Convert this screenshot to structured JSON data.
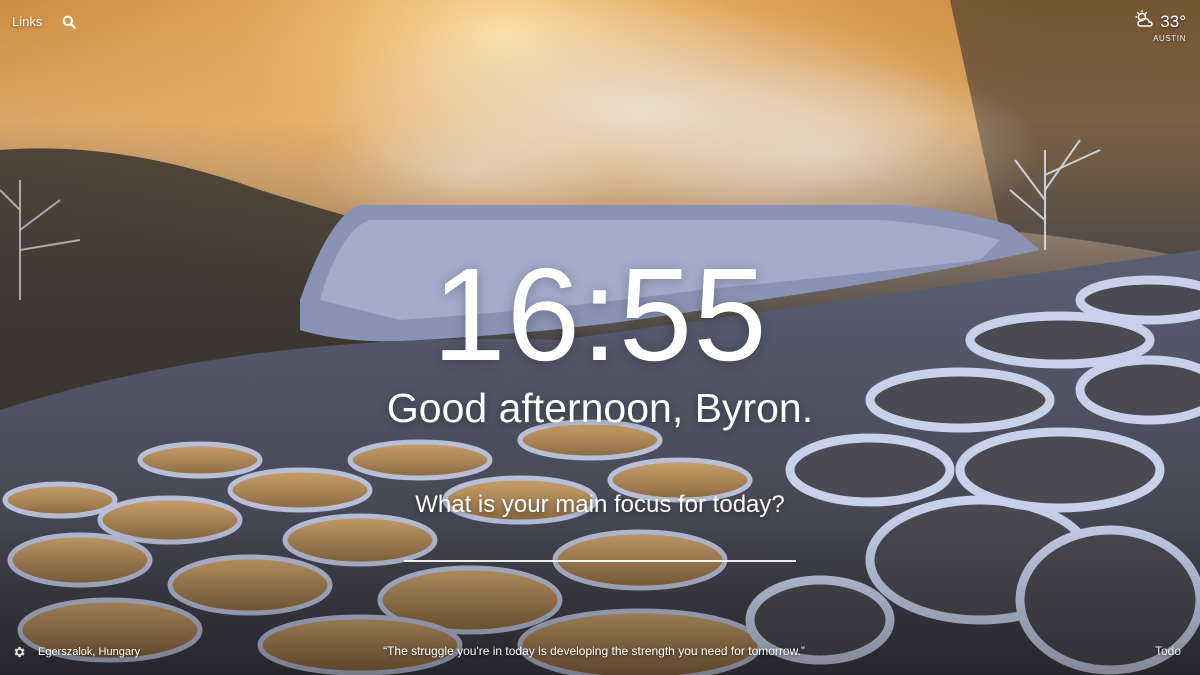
{
  "background": {
    "scene": "Terraced travertine pools with steam at sunset",
    "photo_location": "Egerszalok, Hungary"
  },
  "top_left": {
    "links_label": "Links",
    "search_icon": "search-icon"
  },
  "weather": {
    "icon": "partly-cloudy-icon",
    "temperature": "33°",
    "location": "AUSTIN"
  },
  "clock": {
    "time": "16:55"
  },
  "greeting": {
    "text": "Good afternoon, Byron."
  },
  "focus": {
    "question": "What is your main focus for today?",
    "value": "",
    "placeholder": ""
  },
  "bottom": {
    "settings_icon": "gear-icon",
    "photo_location": "Egerszalok, Hungary",
    "quote": "“The struggle you're in today is developing the strength you need for tomorrow.”",
    "todo_label": "Todo"
  }
}
